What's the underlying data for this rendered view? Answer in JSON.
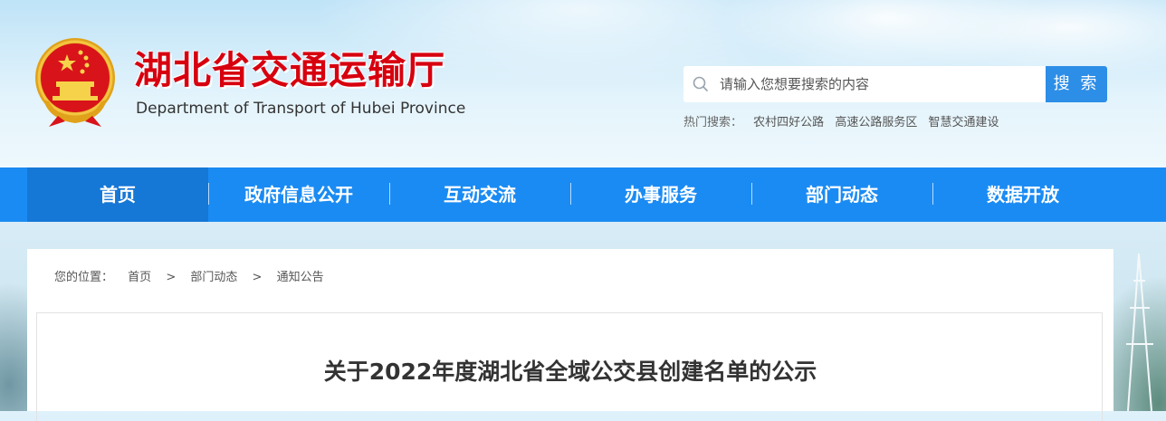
{
  "header": {
    "title": "湖北省交通运输厅",
    "subtitle": "Department of Transport of Hubei Province",
    "emblem_icon": "national-emblem-icon"
  },
  "search": {
    "placeholder": "请输入您想要搜索的内容",
    "value": "",
    "button_label": "搜 索",
    "hot_label": "热门搜索：",
    "hot_keywords": [
      "农村四好公路",
      "高速公路服务区",
      "智慧交通建设"
    ]
  },
  "nav": {
    "items": [
      "首页",
      "政府信息公开",
      "互动交流",
      "办事服务",
      "部门动态",
      "数据开放"
    ],
    "active_index": 0
  },
  "breadcrumb": {
    "label": "您的位置：",
    "items": [
      "首页",
      "部门动态",
      "通知公告"
    ],
    "separator": ">"
  },
  "article": {
    "title": "关于2022年度湖北省全域公交县创建名单的公示"
  },
  "colors": {
    "brand_red": "#d7000f",
    "nav_blue": "#1a8bf3",
    "nav_active": "#1577d6",
    "search_button": "#2d8ee8"
  }
}
